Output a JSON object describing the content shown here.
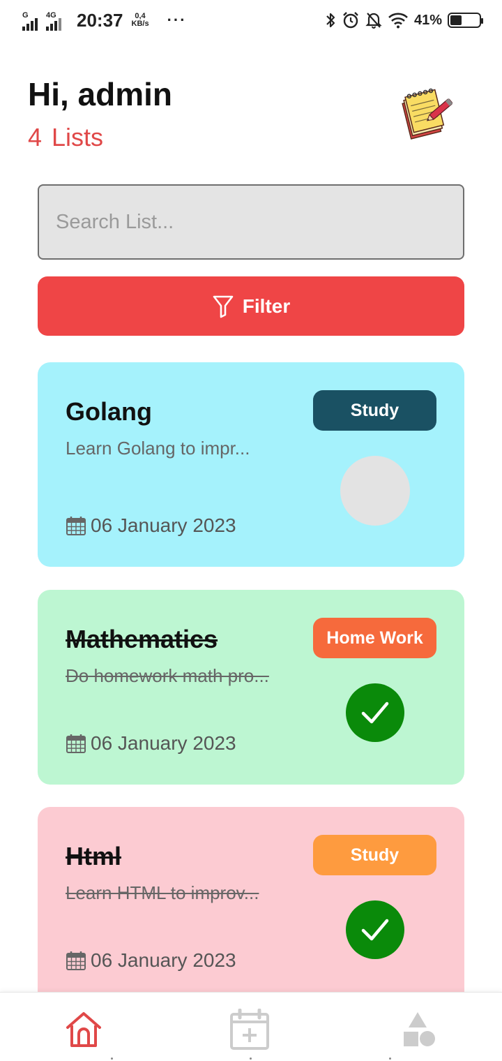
{
  "status_bar": {
    "network_labels": [
      "G",
      "4G"
    ],
    "time": "20:37",
    "speed_value": "0,4",
    "speed_unit": "KB/s",
    "more": "···",
    "battery_percent": "41%",
    "battery_level": 0.41,
    "icons": [
      "signal-icon",
      "bluetooth-icon",
      "alarm-icon",
      "mute-icon",
      "wifi-icon",
      "battery-icon"
    ]
  },
  "header": {
    "greeting": "Hi, admin",
    "list_count": "4 Lists",
    "logo": "notepad-pencil-icon"
  },
  "search": {
    "placeholder": "Search List..."
  },
  "filter": {
    "label": "Filter",
    "icon": "filter-icon"
  },
  "cards": [
    {
      "title": "Golang",
      "description": "Learn Golang to impr...",
      "date": "06 January 2023",
      "badge": "Study",
      "badge_color": "#1a5163",
      "background": "#a5f2fc",
      "completed": false
    },
    {
      "title": "Mathematics",
      "description": "Do homework math pro...",
      "date": "06 January 2023",
      "badge": "Home Work",
      "badge_color": "#f66a3c",
      "background": "#bdf6d2",
      "completed": true
    },
    {
      "title": "Html",
      "description": "Learn HTML to improv...",
      "date": "06 January 2023",
      "badge": "Study",
      "badge_color": "#fe9b3f",
      "background": "#fccbd2",
      "completed": true
    }
  ],
  "bottom_nav": {
    "items": [
      {
        "icon": "home-icon",
        "active": true
      },
      {
        "icon": "calendar-add-icon",
        "active": false
      },
      {
        "icon": "shapes-icon",
        "active": false
      }
    ],
    "active_color": "#e04848",
    "inactive_color": "#cccccc"
  }
}
